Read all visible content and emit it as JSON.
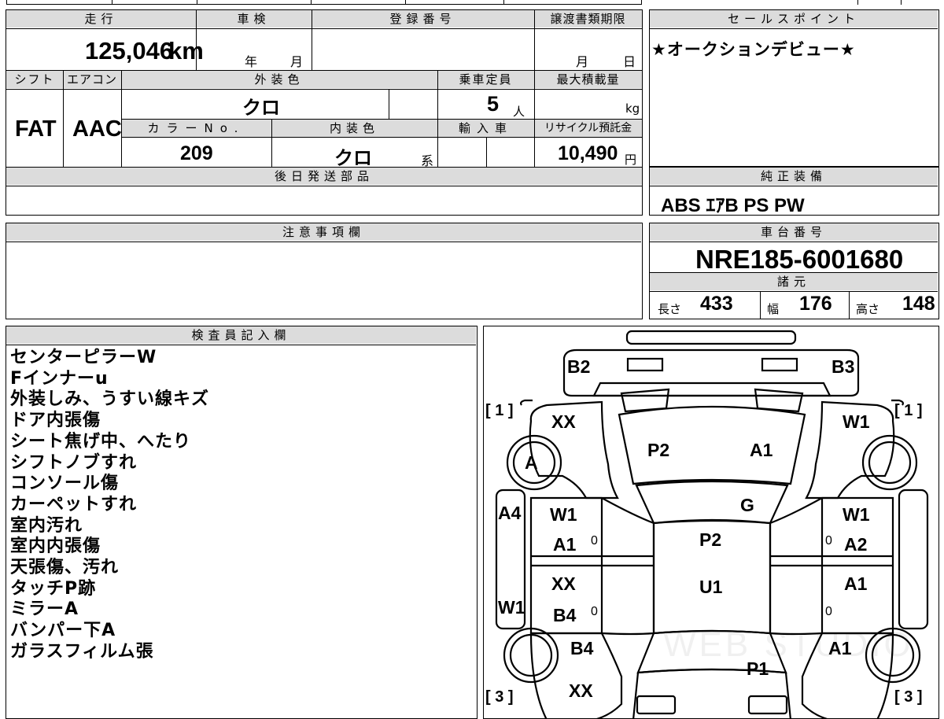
{
  "spec": {
    "mileage_label": "走行",
    "mileage_value": "125,046",
    "mileage_unit": "km",
    "shaken_label": "車検",
    "shaken_year_unit": "年",
    "shaken_month_unit": "月",
    "registration_label": "登録番号",
    "transfer_deadline_label": "譲渡書類期限",
    "transfer_month_unit": "月",
    "transfer_day_unit": "日",
    "shift_label": "シフト",
    "shift_value": "FAT",
    "aircon_label": "エアコン",
    "aircon_value": "AAC",
    "exterior_color_label": "外装色",
    "exterior_color_value": "クロ",
    "capacity_label": "乗車定員",
    "capacity_value": "5",
    "capacity_unit": "人",
    "max_load_label": "最大積載量",
    "max_load_unit": "kg",
    "color_no_label": "カラーNo.",
    "color_no_value": "209",
    "interior_color_label": "内装色",
    "interior_color_value": "クロ",
    "interior_color_suffix": "系",
    "import_label": "輸入車",
    "recycle_label": "リサイクル預託金",
    "recycle_value": "10,490",
    "recycle_unit": "円",
    "later_parts_label": "後日発送部品"
  },
  "sales": {
    "label": "セールスポイント",
    "text": "★オークションデビュー★"
  },
  "equipment": {
    "label": "純正装備",
    "value": "ABS ｴｱB PS PW"
  },
  "caution": {
    "label": "注意事項欄"
  },
  "chassis": {
    "label": "車台番号",
    "value": "NRE185-6001680",
    "spec_label": "諸元",
    "length_label": "長さ",
    "length_value": "433",
    "width_label": "幅",
    "width_value": "176",
    "height_label": "高さ",
    "height_value": "148"
  },
  "inspector": {
    "label": "検査員記入欄",
    "notes": [
      "センターピラーW",
      "Fインナーu",
      "外装しみ、うすい線キズ",
      "ドア内張傷",
      "シート焦げ中、へたり",
      "シフトノブすれ",
      "コンソール傷",
      "カーペットすれ",
      "室内汚れ",
      "室内内張傷",
      "天張傷、汚れ",
      "タッチP跡",
      "ミラーA",
      "バンパー下A",
      "ガラスフィルム張"
    ]
  },
  "diagram": {
    "labels": {
      "b2": "B2",
      "b3": "B3",
      "xx_front_left": "XX",
      "w1_front_right": "W1",
      "tire_a": "A",
      "p2_hood": "P2",
      "a1_hood": "A1",
      "g_windshield": "G",
      "a4_left_sill": "A4",
      "w1_fl_door": "W1",
      "a1_fl_door": "A1",
      "w1_fr_door": "W1",
      "a2_fr_door": "A2",
      "p2_roof": "P2",
      "xx_rl_door": "XX",
      "b4_rl_door": "B4",
      "a1_rr_door": "A1",
      "u1_roof": "U1",
      "w1_left_sill": "W1",
      "b4_rear_left": "B4",
      "a1_rear_right": "A1",
      "p1_trunk": "P1",
      "xx_rear_bottom": "XX"
    },
    "zeros": [
      "0",
      "0",
      "0",
      "0"
    ],
    "brackets": {
      "front_left": "[ 1 ]",
      "front_right": "[ 1 ]",
      "rear_left": "[ 3 ]",
      "rear_right": "[ 3 ]"
    }
  }
}
